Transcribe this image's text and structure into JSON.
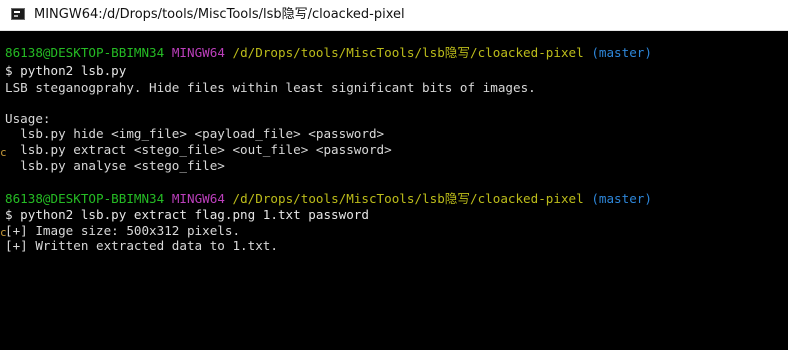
{
  "window": {
    "title": "MINGW64:/d/Drops/tools/MiscTools/lsb隐写/cloacked-pixel",
    "icon": "terminal-icon"
  },
  "colors": {
    "background": "#000000",
    "user_host": "#25bc24",
    "shell": "#bc3fbc",
    "path": "#bcbc1a",
    "branch": "#2d86d9",
    "text": "#d8d8d8"
  },
  "prompt1": {
    "user_host": "86138@DESKTOP-BBIMN34",
    "shell": "MINGW64",
    "path": "/d/Drops/tools/MiscTools/lsb隐写/cloacked-pixel",
    "branch": "(master)",
    "command": "$ python2 lsb.py"
  },
  "output1": {
    "description": "LSB steganogprahy. Hide files within least significant bits of images.",
    "usage_header": "Usage:",
    "usage_hide": "  lsb.py hide <img_file> <payload_file> <password>",
    "usage_extract": "  lsb.py extract <stego_file> <out_file> <password>",
    "usage_analyse": "  lsb.py analyse <stego_file>"
  },
  "prompt2": {
    "user_host": "86138@DESKTOP-BBIMN34",
    "shell": "MINGW64",
    "path": "/d/Drops/tools/MiscTools/lsb隐写/cloacked-pixel",
    "branch": "(master)",
    "command": "$ python2 lsb.py extract flag.png 1.txt password"
  },
  "output2": {
    "image_size": "[+] Image size: 500x312 pixels.",
    "written": "[+] Written extracted data to 1.txt."
  },
  "margin_marks": {
    "mark1": "c",
    "mark2": "c"
  }
}
